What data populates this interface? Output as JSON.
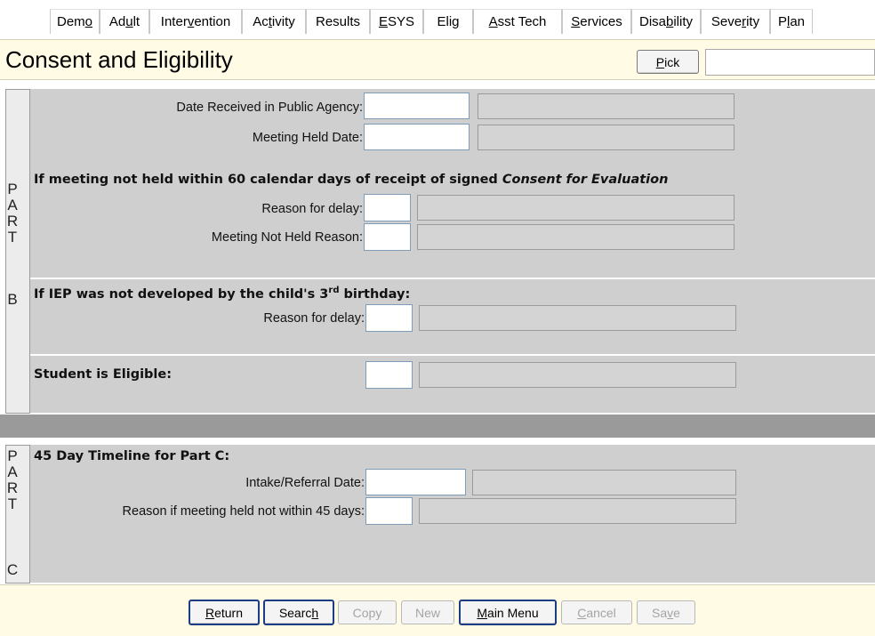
{
  "tabs": [
    {
      "pre": "Dem",
      "u": "o",
      "post": ""
    },
    {
      "pre": "Ad",
      "u": "u",
      "post": "lt"
    },
    {
      "pre": "Inter",
      "u": "v",
      "post": "ention"
    },
    {
      "pre": "Ac",
      "u": "t",
      "post": "ivity"
    },
    {
      "pre": "Results",
      "u": "",
      "post": ""
    },
    {
      "pre": "",
      "u": "E",
      "post": "SYS"
    },
    {
      "pre": "Eli",
      "u": "g",
      "post": ""
    },
    {
      "pre": "",
      "u": "A",
      "post": "sst Tech"
    },
    {
      "pre": "",
      "u": "S",
      "post": "ervices"
    },
    {
      "pre": "Disa",
      "u": "b",
      "post": "ility"
    },
    {
      "pre": "Seve",
      "u": "r",
      "post": "ity"
    },
    {
      "pre": "P",
      "u": "l",
      "post": "an"
    }
  ],
  "header": {
    "title": "Consent and Eligibility",
    "pick_pre": "",
    "pick_u": "P",
    "pick_post": "ick",
    "pick_value": ""
  },
  "part_b": {
    "letters": [
      "P",
      "A",
      "R",
      "T",
      "B"
    ],
    "date_received_label": "Date Received in Public Agency:",
    "meeting_held_label": "Meeting Held Date:",
    "delay_heading_pre": "If meeting not held within 60 calendar days of receipt of signed ",
    "delay_heading_em": "Consent for Evaluation",
    "reason_delay_label": "Reason for delay:",
    "not_held_label": "Meeting Not Held Reason:",
    "iep_heading_pre": "If IEP was not developed by the child's 3",
    "iep_heading_sup": "rd",
    "iep_heading_post": " birthday:",
    "iep_reason_label": "Reason for delay:",
    "eligible_label": "Student is Eligible:"
  },
  "part_c": {
    "letters": [
      "P",
      "A",
      "R",
      "T",
      "C"
    ],
    "heading": "45 Day Timeline for Part C:",
    "intake_label": "Intake/Referral Date:",
    "reason45_label": "Reason if meeting held not within 45 days:"
  },
  "footer": {
    "return_pre": "",
    "return_u": "R",
    "return_post": "eturn",
    "search_pre": "Searc",
    "search_u": "h",
    "search_post": "",
    "copy": "Copy",
    "new": "New",
    "mainmenu_pre": "",
    "mainmenu_u": "M",
    "mainmenu_post": "ain Menu",
    "cancel_pre": "",
    "cancel_u": "C",
    "cancel_post": "ancel",
    "save_pre": "Sa",
    "save_u": "v",
    "save_post": "e"
  }
}
